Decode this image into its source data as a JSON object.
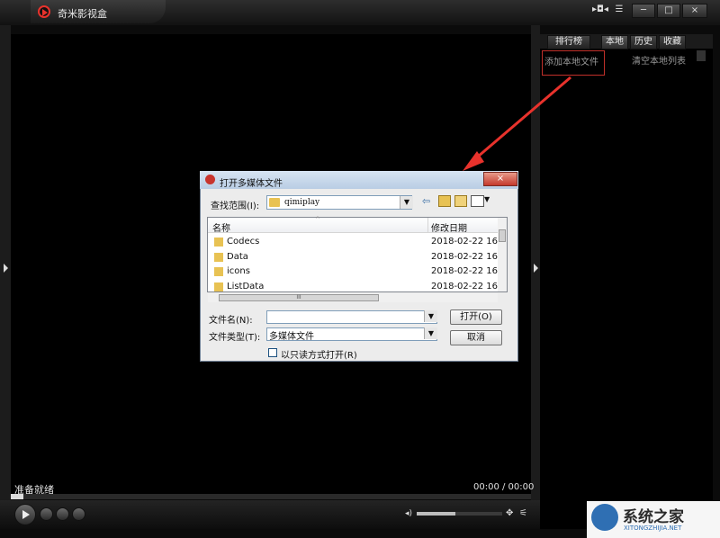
{
  "app": {
    "title": "奇米影视盒",
    "window_controls": {
      "extra": "▸◘◂",
      "menu": "☰",
      "minimize": "─",
      "maximize": "□",
      "close": "×"
    }
  },
  "player": {
    "status": "准备就绪",
    "time": "00:00 / 00:00",
    "progress_fraction": 0,
    "volume_fraction": 0.45
  },
  "playlist": {
    "tabs": [
      "排行榜",
      "本地",
      "历史",
      "收藏"
    ],
    "active_tab": 1,
    "add_local_label": "添加本地文件",
    "clear_list_label": "清空本地列表"
  },
  "dialog": {
    "title": "打开多媒体文件",
    "close_label": "×",
    "lookin_label": "查找范围(I):",
    "lookin_value": "qimiplay",
    "columns": [
      "名称",
      "修改日期"
    ],
    "rows": [
      {
        "name": "Codecs",
        "date": "2018-02-22 16:"
      },
      {
        "name": "Data",
        "date": "2018-02-22 16:"
      },
      {
        "name": "icons",
        "date": "2018-02-22 16:"
      },
      {
        "name": "ListData",
        "date": "2018-02-22 16:"
      }
    ],
    "hscroll_label": "III",
    "filename_label": "文件名(N):",
    "filename_value": "",
    "filetype_label": "文件类型(T):",
    "filetype_value": "多媒体文件",
    "open_label": "打开(O)",
    "cancel_label": "取消",
    "readonly_label": "以只读方式打开(R)"
  },
  "watermark": {
    "brand": "系统之家",
    "url": "XITONGZHIJIA.NET"
  },
  "colors": {
    "accent_red": "#e8322c",
    "highlight_box": "#c0302a",
    "background": "#000000"
  }
}
